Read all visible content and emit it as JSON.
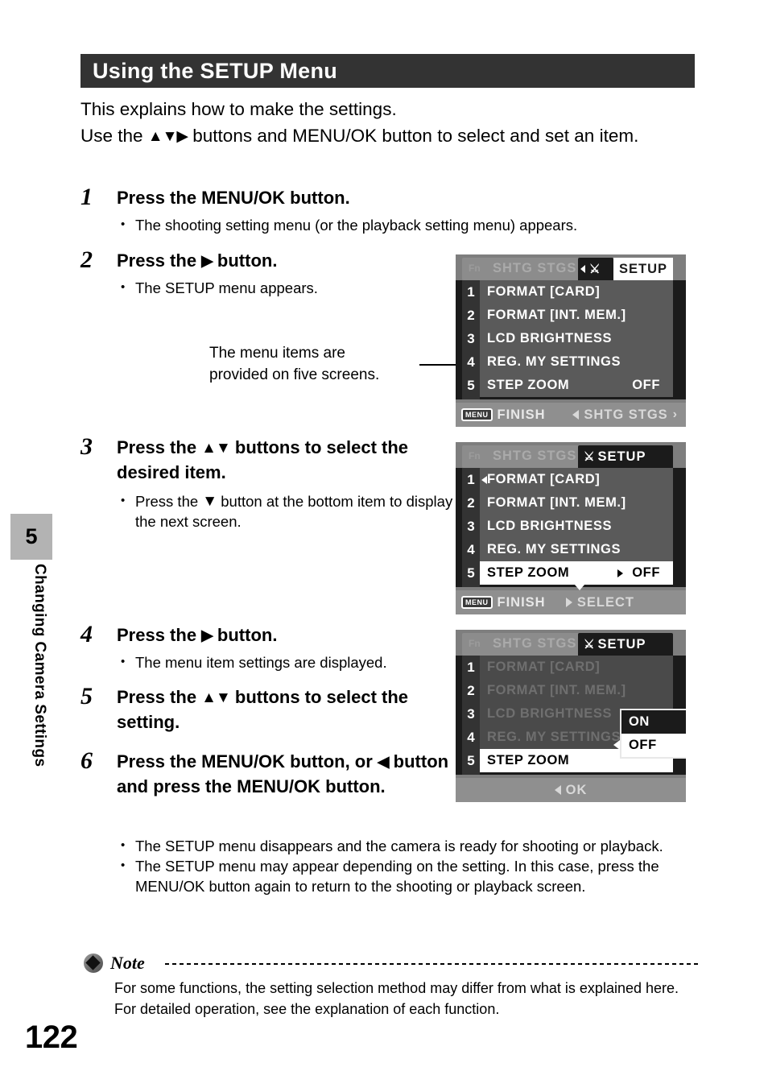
{
  "page": {
    "number": "122",
    "chapter_number": "5",
    "chapter_title": "Changing Camera Settings"
  },
  "header": {
    "title": "Using the SETUP Menu"
  },
  "intro": {
    "line1": "This explains how to make the settings.",
    "line2_a": "Use the ",
    "line2_triangles": "▲▼▶",
    "line2_b": " buttons and MENU/OK button to select and set an item."
  },
  "callout": {
    "line1": "The menu items are",
    "line2": "provided on five screens."
  },
  "steps": [
    {
      "number": "1",
      "title": "Press the MENU/OK button.",
      "bullets": [
        "The shooting setting menu (or the playback setting menu) appears."
      ]
    },
    {
      "number": "2",
      "title_a": "Press the ",
      "title_icon": "▶",
      "title_b": " button.",
      "bullets": [
        "The SETUP menu appears."
      ]
    },
    {
      "number": "3",
      "title_a": "Press the ",
      "title_icon": "▲▼",
      "title_b": " buttons to select the desired item.",
      "bullet_a": "Press the ",
      "bullet_icon": "▼",
      "bullet_b": " button at the bottom item to display the next screen."
    },
    {
      "number": "4",
      "title_a": "Press the ",
      "title_icon": "▶",
      "title_b": " button.",
      "bullets": [
        "The menu item settings are displayed."
      ]
    },
    {
      "number": "5",
      "title_a": "Press the ",
      "title_icon": "▲▼",
      "title_b": " buttons to select the setting."
    },
    {
      "number": "6",
      "title_a": "Press the MENU/OK button, or ",
      "title_icon": "◀",
      "title_b": " button and press the MENU/OK button.",
      "bullets": [
        "The SETUP menu disappears and the camera is ready for shooting or playback.",
        "The SETUP menu may appear depending on the setting. In this case, press the MENU/OK button again to return to the shooting or playback screen."
      ]
    }
  ],
  "lcd_screens": [
    {
      "id": "screen-setup-overview",
      "tab_fn": "Fn",
      "tab_inactive": "SHTG STGS",
      "tab_active": "SETUP",
      "tab_icon": "wrench-screwdriver-icon",
      "rows": [
        {
          "index": "1",
          "name": "FORMAT  [CARD]",
          "value": ""
        },
        {
          "index": "2",
          "name": "FORMAT  [INT. MEM.]",
          "value": ""
        },
        {
          "index": "3",
          "name": "LCD BRIGHTNESS",
          "value": ""
        },
        {
          "index": "4",
          "name": "REG. MY SETTINGS",
          "value": ""
        },
        {
          "index": "5",
          "name": "STEP ZOOM",
          "value": "OFF"
        }
      ],
      "status_key": "MENU",
      "status_left": "FINISH",
      "status_right": "SHTG STGS"
    },
    {
      "id": "screen-setup-select-item",
      "tab_fn": "Fn",
      "tab_inactive": "SHTG STGS",
      "tab_active": "SETUP",
      "tab_icon": "wrench-screwdriver-icon",
      "rows": [
        {
          "index": "1",
          "name": "FORMAT  [CARD]",
          "value": ""
        },
        {
          "index": "2",
          "name": "FORMAT  [INT. MEM.]",
          "value": ""
        },
        {
          "index": "3",
          "name": "LCD BRIGHTNESS",
          "value": ""
        },
        {
          "index": "4",
          "name": "REG. MY SETTINGS",
          "value": ""
        },
        {
          "index": "5",
          "name": "STEP ZOOM",
          "value": "OFF"
        }
      ],
      "selected_index": "5",
      "status_key": "MENU",
      "status_left": "FINISH",
      "status_center": "SELECT"
    },
    {
      "id": "screen-setup-step-zoom-options",
      "tab_fn": "Fn",
      "tab_inactive": "SHTG STGS",
      "tab_active": "SETUP",
      "tab_icon": "wrench-screwdriver-icon",
      "rows": [
        {
          "index": "1",
          "name": "FORMAT  [CARD]",
          "value": ""
        },
        {
          "index": "2",
          "name": "FORMAT  [INT. MEM.]",
          "value": ""
        },
        {
          "index": "3",
          "name": "LCD BRIGHTNESS",
          "value": ""
        },
        {
          "index": "4",
          "name": "REG. MY SETTINGS",
          "value": ""
        },
        {
          "index": "5",
          "name": "STEP ZOOM",
          "value": ""
        }
      ],
      "selected_index": "5",
      "submenu_options": [
        "ON",
        "OFF"
      ],
      "submenu_selected": "OFF",
      "status_center": "OK"
    }
  ],
  "note": {
    "label": "Note",
    "text": "For some functions, the setting selection method may differ from what is explained here. For detailed operation, see the explanation of each function."
  },
  "colors": {
    "header_bg": "#333333",
    "chapter_tab_bg": "#b3b3b3",
    "lcd_bg": "#1b1b1b",
    "lcd_row": "#5a5a5a",
    "lcd_status": "#8f8f8f"
  }
}
